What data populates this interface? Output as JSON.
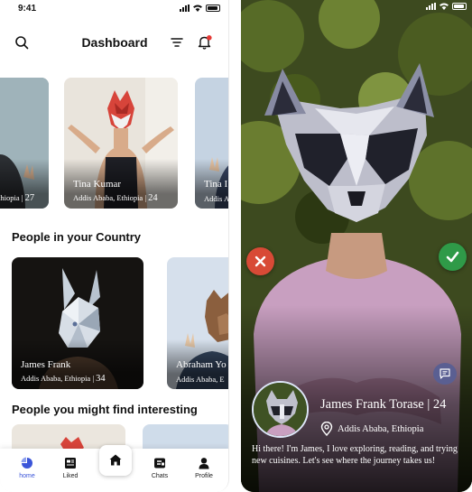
{
  "status_bar": {
    "time": "9:41"
  },
  "dashboard": {
    "title": "Dashboard",
    "top_cards": [
      {
        "name": "",
        "location": "thiopia",
        "age": "27"
      },
      {
        "name": "Tina Kumar",
        "location": "Addis Ababa, Ethiopia",
        "age": "24"
      },
      {
        "name": "Tina I",
        "location": "Addis A",
        "age": ""
      }
    ],
    "section_country": "People in your Country",
    "country_cards": [
      {
        "name": "James Frank",
        "location": "Addis Ababa, Ethiopia",
        "age": "34"
      },
      {
        "name": "Abraham Yo",
        "location": "Addis Ababa, E",
        "age": ""
      }
    ],
    "section_interesting": "People you might find interesting"
  },
  "nav": {
    "home": "home",
    "liked": "Liked",
    "chats": "Chats",
    "profile": "Profile"
  },
  "profile_view": {
    "name": "James Frank Torase",
    "age": "24",
    "location": "Addis Ababa, Ethiopia",
    "bio": "Hi there! I'm James, I love exploring, reading, and trying new cuisines. Let's see where the journey takes us!"
  },
  "colors": {
    "accent": "#3b55d9",
    "reject": "#d84a36",
    "accept": "#2f9a48",
    "notification_dot": "#e53935"
  }
}
